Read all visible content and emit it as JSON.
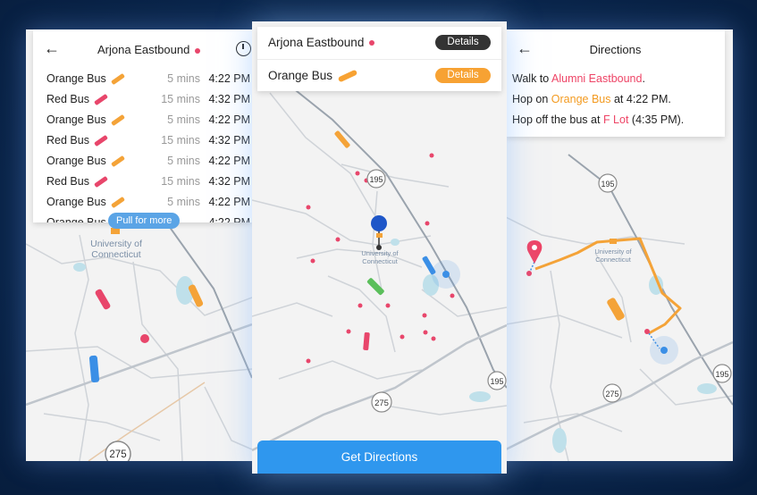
{
  "left": {
    "title": "Arjona Eastbound",
    "rows": [
      {
        "bus": "Orange Bus",
        "color": "#f4a338",
        "mins": "5 mins",
        "time": "4:22 PM"
      },
      {
        "bus": "Red Bus",
        "color": "#e8466b",
        "mins": "15 mins",
        "time": "4:32 PM"
      },
      {
        "bus": "Orange Bus",
        "color": "#f4a338",
        "mins": "5 mins",
        "time": "4:22 PM"
      },
      {
        "bus": "Red Bus",
        "color": "#e8466b",
        "mins": "15 mins",
        "time": "4:32 PM"
      },
      {
        "bus": "Orange Bus",
        "color": "#f4a338",
        "mins": "5 mins",
        "time": "4:22 PM"
      },
      {
        "bus": "Red Bus",
        "color": "#e8466b",
        "mins": "15 mins",
        "time": "4:32 PM"
      },
      {
        "bus": "Orange Bus",
        "color": "#f4a338",
        "mins": "5 mins",
        "time": "4:22 PM"
      },
      {
        "bus": "Orange Bus",
        "color": "#f4a338",
        "mins": "",
        "time": "4:22 PM"
      }
    ],
    "pull_label": "Pull for more",
    "map_label_line1": "University of",
    "map_label_line2": "Connecticut",
    "shield_275": "275"
  },
  "center": {
    "route_name": "Arjona Eastbound",
    "bus_name": "Orange Bus",
    "details_label_1": "Details",
    "details_label_2": "Details",
    "details_color_1": "#333333",
    "details_color_2": "#f7a233",
    "shield_195_top": "195",
    "shield_195_bottom": "195",
    "shield_275": "275",
    "map_label_line1": "University of",
    "map_label_line2": "Connecticut",
    "get_directions": "Get Directions"
  },
  "right": {
    "title": "Directions",
    "walk_prefix": "Walk to ",
    "walk_stop": "Alumni Eastbound",
    "walk_suffix": ".",
    "hop_on_prefix": "Hop on ",
    "hop_on_bus": "Orange Bus",
    "hop_on_suffix": " at 4:22 PM.",
    "hop_off_prefix": "Hop off the bus at ",
    "hop_off_stop": "F Lot",
    "hop_off_suffix": " (4:35 PM).",
    "shield_195_top": "195",
    "shield_195_right": "195",
    "shield_275": "275",
    "map_label_line1": "University of",
    "map_label_line2": "Connecticut"
  },
  "colors": {
    "accent_blue": "#2f97ee",
    "orange": "#f4a338",
    "red": "#e8466b",
    "background": "#0c2a52"
  }
}
